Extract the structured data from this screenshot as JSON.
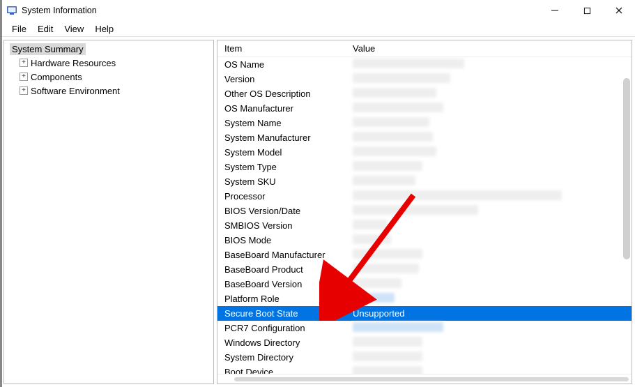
{
  "window": {
    "title": "System Information"
  },
  "menu": {
    "items": [
      "File",
      "Edit",
      "View",
      "Help"
    ]
  },
  "tree": {
    "root_label": "System Summary",
    "children": [
      "Hardware Resources",
      "Components",
      "Software Environment"
    ]
  },
  "details": {
    "columns": {
      "item": "Item",
      "value": "Value"
    },
    "rows": [
      {
        "item": "OS Name",
        "value": "",
        "blurW": 160
      },
      {
        "item": "Version",
        "value": "",
        "blurW": 140
      },
      {
        "item": "Other OS Description",
        "value": "",
        "blurW": 120
      },
      {
        "item": "OS Manufacturer",
        "value": "",
        "blurW": 130
      },
      {
        "item": "System Name",
        "value": "",
        "blurW": 110
      },
      {
        "item": "System Manufacturer",
        "value": "",
        "blurW": 115
      },
      {
        "item": "System Model",
        "value": "",
        "blurW": 120
      },
      {
        "item": "System Type",
        "value": "",
        "blurW": 100
      },
      {
        "item": "System SKU",
        "value": "",
        "blurW": 90
      },
      {
        "item": "Processor",
        "value": "",
        "blurW": 300
      },
      {
        "item": "BIOS Version/Date",
        "value": "",
        "blurW": 180
      },
      {
        "item": "SMBIOS Version",
        "value": "",
        "blurW": 50
      },
      {
        "item": "BIOS Mode",
        "value": "",
        "blurW": 55
      },
      {
        "item": "BaseBoard Manufacturer",
        "value": "",
        "blurW": 100
      },
      {
        "item": "BaseBoard Product",
        "value": "",
        "blurW": 95
      },
      {
        "item": "BaseBoard Version",
        "value": "",
        "blurW": 70
      },
      {
        "item": "Platform Role",
        "value": "",
        "blurW": 60,
        "blurColor": "#cfe3f7"
      },
      {
        "item": "Secure Boot State",
        "value": "Unsupported",
        "selected": true
      },
      {
        "item": "PCR7 Configuration",
        "value": "",
        "blurW": 130,
        "blurColor": "#cfe3f7"
      },
      {
        "item": "Windows Directory",
        "value": "",
        "blurW": 100
      },
      {
        "item": "System Directory",
        "value": "",
        "blurW": 100
      },
      {
        "item": "Boot Device",
        "value": "",
        "blurW": 100
      }
    ]
  }
}
